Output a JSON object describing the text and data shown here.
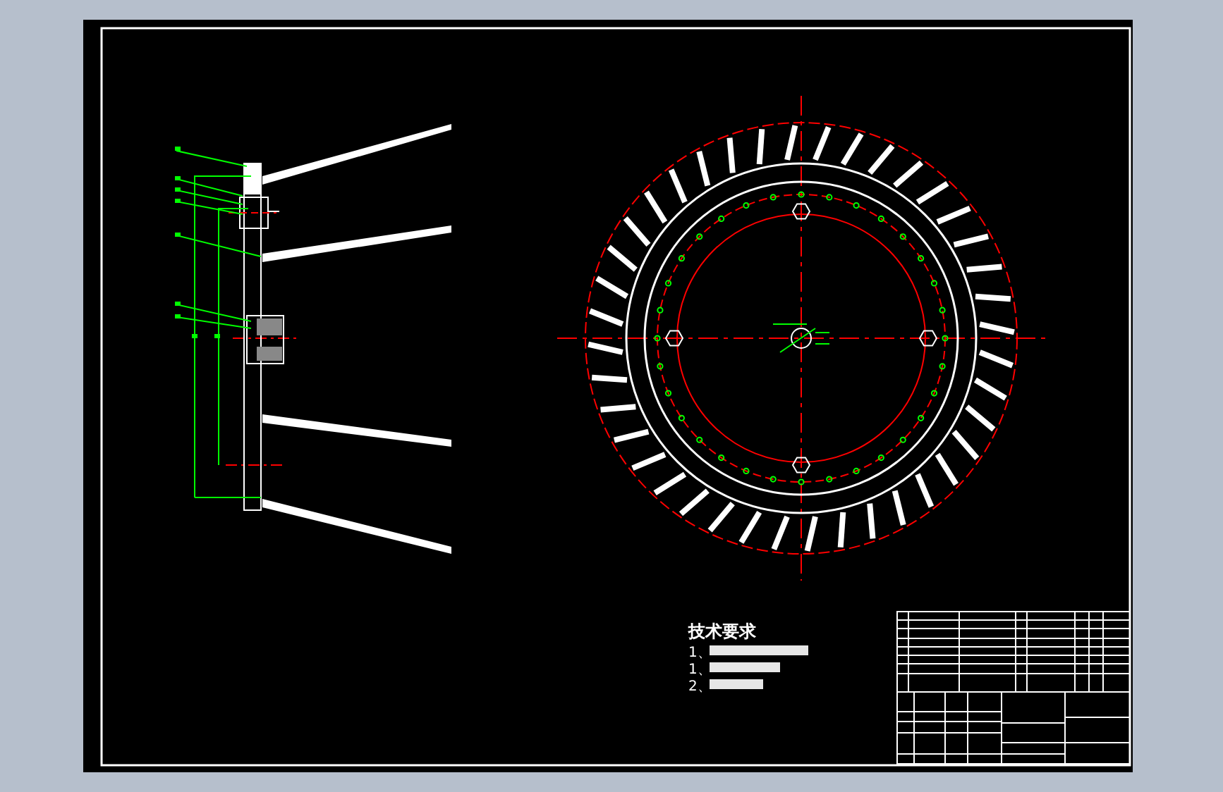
{
  "drawing": {
    "technical_requirements": {
      "heading": "技术要求",
      "items": [
        "1、",
        "1、",
        "2、"
      ]
    }
  }
}
